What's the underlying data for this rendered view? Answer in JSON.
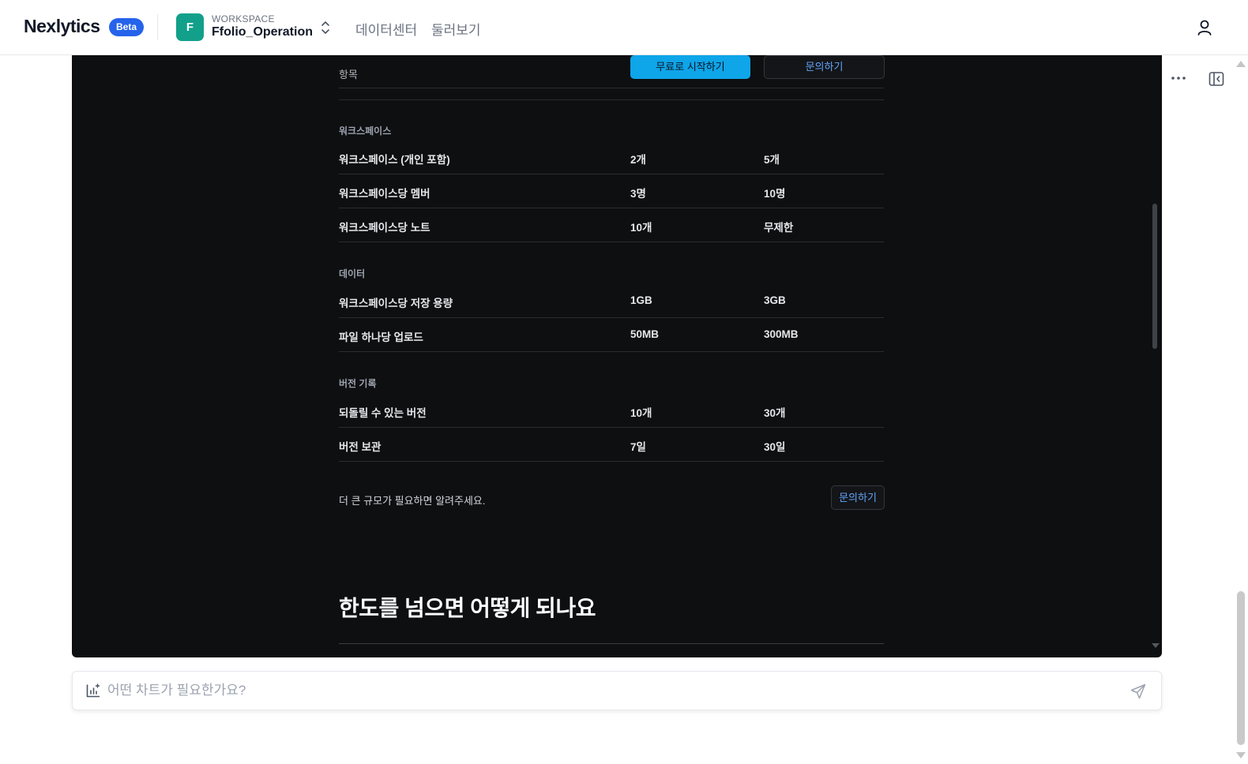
{
  "brand": {
    "name": "Nexlytics",
    "badge": "Beta"
  },
  "workspace": {
    "initial": "F",
    "label": "WORKSPACE",
    "name": "Ffolio_Operation"
  },
  "nav": {
    "links": [
      "데이터센터",
      "둘러보기"
    ]
  },
  "colors": {
    "brand_blue": "#2563eb",
    "workspace_teal": "#12a08a",
    "cta_sky": "#0ea5e9",
    "panel_bg": "#0e0f11"
  },
  "pricing": {
    "header_label": "항목",
    "free_button": "무료로 시작하기",
    "contact_button": "문의하기",
    "sections": [
      {
        "title": "워크스페이스",
        "rows": [
          {
            "item": "워크스페이스 (개인 포함)",
            "free": "2개",
            "pro": "5개"
          },
          {
            "item": "워크스페이스당 멤버",
            "free": "3명",
            "pro": "10명"
          },
          {
            "item": "워크스페이스당 노트",
            "free": "10개",
            "pro": "무제한"
          }
        ]
      },
      {
        "title": "데이터",
        "rows": [
          {
            "item": "워크스페이스당 저장 용량",
            "free": "1GB",
            "pro": "3GB"
          },
          {
            "item": "파일 하나당 업로드",
            "free": "50MB",
            "pro": "300MB"
          }
        ]
      },
      {
        "title": "버전 기록",
        "rows": [
          {
            "item": "되돌릴 수 있는 버전",
            "free": "10개",
            "pro": "30개"
          },
          {
            "item": "버전 보관",
            "free": "7일",
            "pro": "30일"
          }
        ]
      }
    ],
    "footer_text": "더 큰 규모가 필요하면 알려주세요.",
    "footer_button": "문의하기",
    "next_heading": "한도를 넘으면 어떻게 되나요"
  },
  "chat": {
    "placeholder": "어떤 차트가 필요한가요?"
  },
  "icons": {
    "workspace_switch": "chevron-up-down-icon",
    "user": "user-icon",
    "more": "more-horizontal-icon",
    "sidebar": "sidebar-collapse-icon",
    "chart": "chart-sparkle-icon",
    "send": "send-icon"
  }
}
